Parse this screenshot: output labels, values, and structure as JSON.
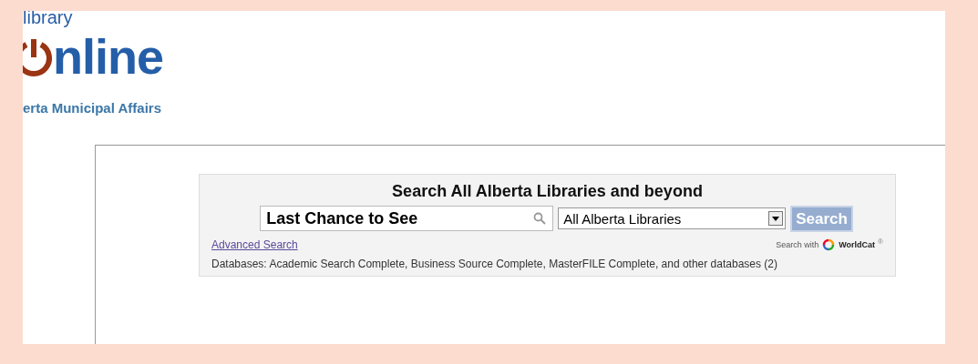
{
  "header": {
    "top_line": "library",
    "wordmark": "nline",
    "subtitle": "erta Municipal Affairs"
  },
  "search": {
    "heading": "Search All Alberta Libraries and beyond",
    "query": "Last Chance to See",
    "scope": "All Alberta Libraries",
    "button": "Search",
    "advanced_link": "Advanced Search",
    "search_with": "Search with",
    "provider": "WorldCat",
    "provider_mark": "®",
    "databases": "Databases: Academic Search Complete, Business Source Complete, MasterFILE Complete, and other databases (2)"
  }
}
